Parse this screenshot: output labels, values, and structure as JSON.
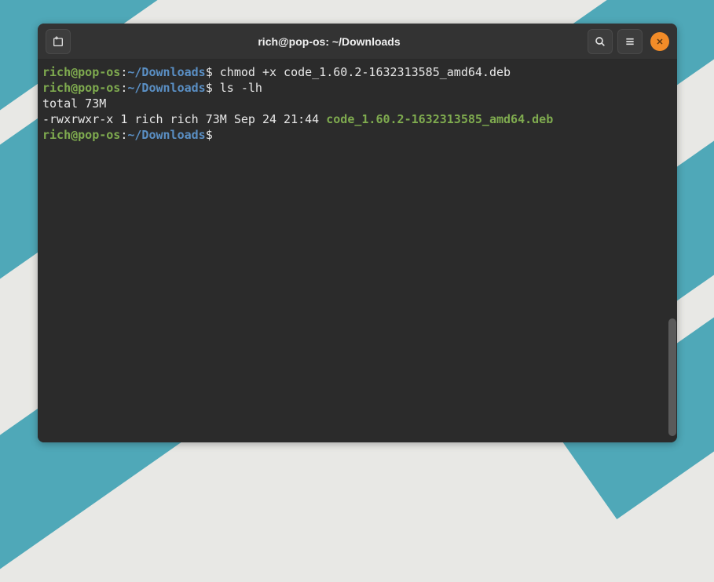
{
  "window": {
    "title": "rich@pop-os: ~/Downloads"
  },
  "prompt": {
    "user_host": "rich@pop-os",
    "separator": ":",
    "path": "~/Downloads",
    "dollar": "$"
  },
  "lines": {
    "cmd1": " chmod +x code_1.60.2-1632313585_amd64.deb",
    "cmd2": " ls -lh",
    "out_total": "total 73M",
    "out_perm": "-rwxrwxr-x 1 rich rich 73M Sep 24 21:44 ",
    "out_file": "code_1.60.2-1632313585_amd64.deb",
    "cmd3": " "
  }
}
